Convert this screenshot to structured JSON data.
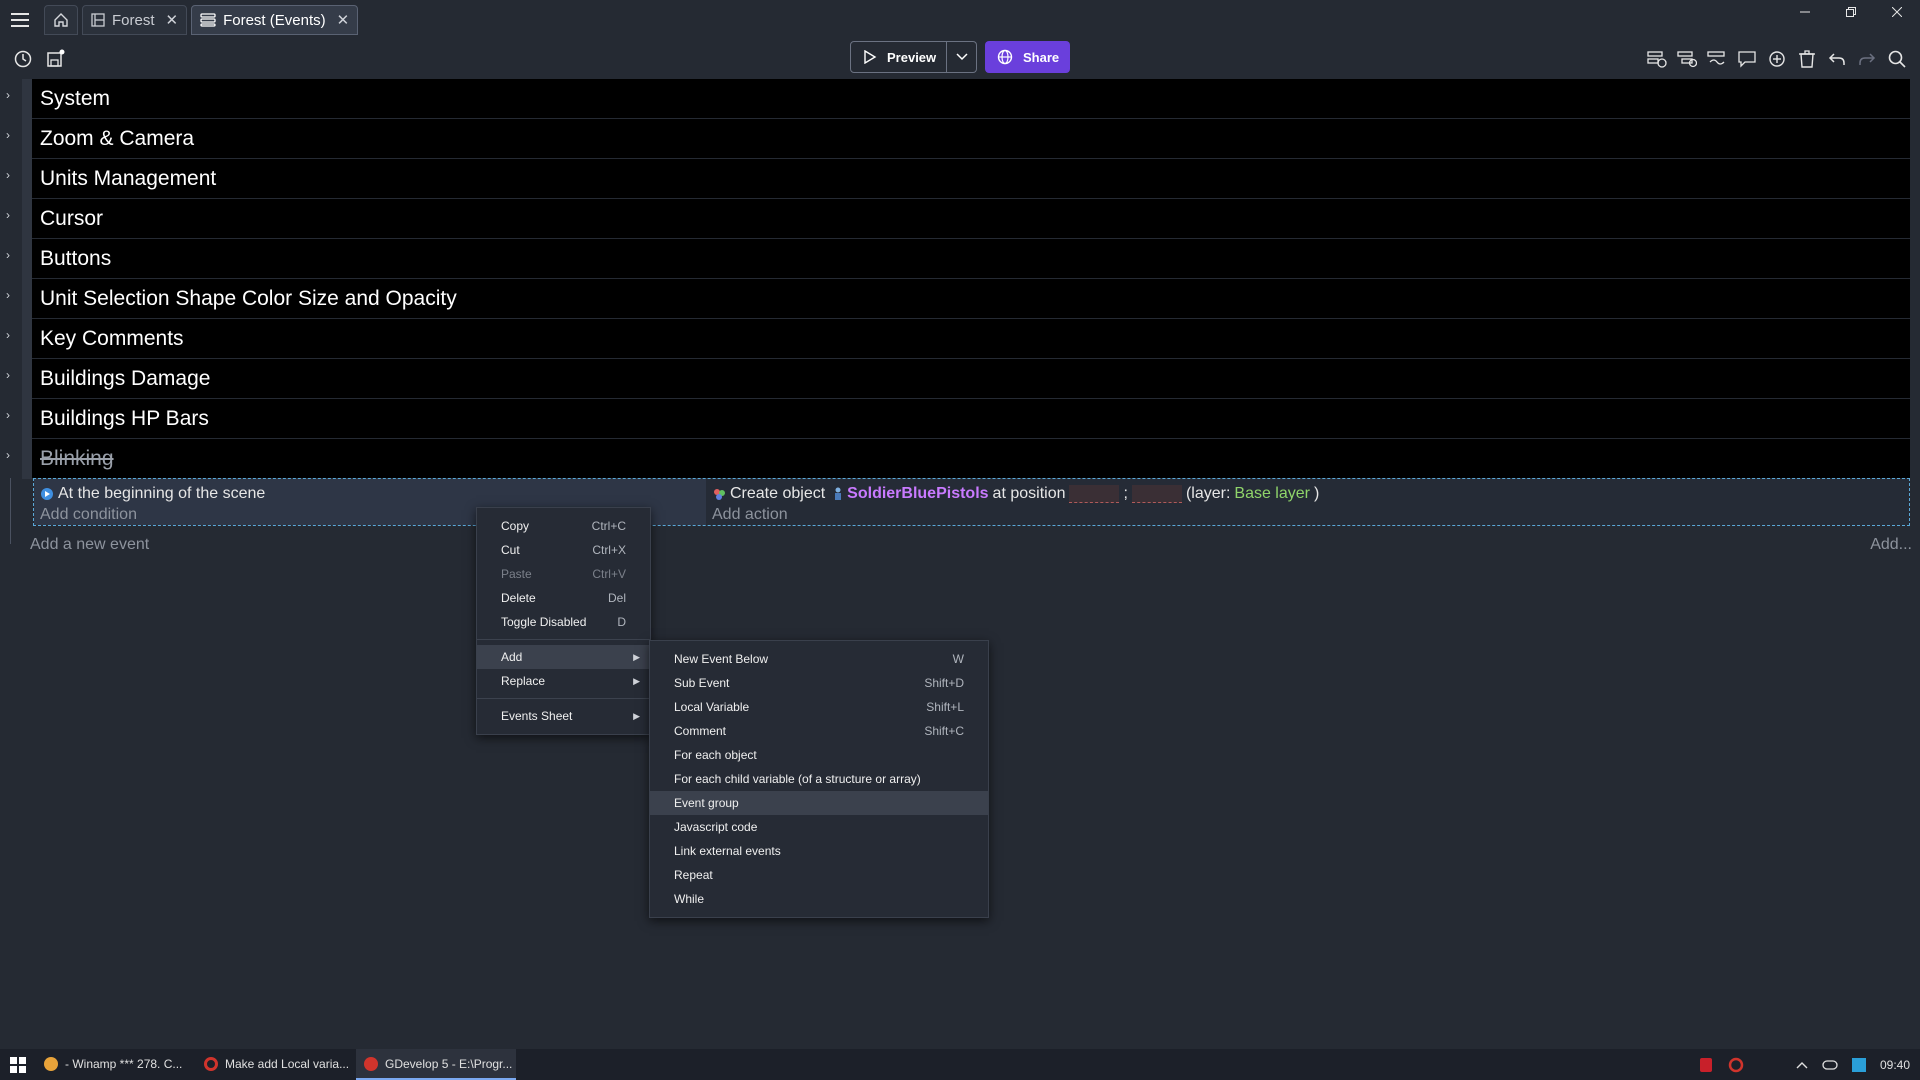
{
  "tabs": [
    {
      "label": "Forest",
      "icon": "scene-icon"
    },
    {
      "label": "Forest (Events)",
      "icon": "events-icon"
    }
  ],
  "toolbar": {
    "preview_label": "Preview",
    "share_label": "Share",
    "share_color": "#6a3fdc"
  },
  "groups": [
    {
      "label": "System",
      "disabled": false
    },
    {
      "label": "Zoom & Camera",
      "disabled": false
    },
    {
      "label": "Units Management",
      "disabled": false
    },
    {
      "label": "Cursor",
      "disabled": false
    },
    {
      "label": "Buttons",
      "disabled": false
    },
    {
      "label": "Unit Selection Shape Color Size and Opacity",
      "disabled": false
    },
    {
      "label": "Key Comments",
      "disabled": false
    },
    {
      "label": "Buildings Damage",
      "disabled": false
    },
    {
      "label": "Buildings HP Bars",
      "disabled": false
    },
    {
      "label": "Blinking",
      "disabled": true
    }
  ],
  "event": {
    "condition": "At the beginning of the scene",
    "add_condition": "Add condition",
    "action_prefix": "Create object",
    "action_object": "SoldierBluePistols",
    "action_mid": "at position",
    "action_sep": ";",
    "action_layer_open": "(layer:",
    "action_layer": "Base layer",
    "action_layer_close": ")",
    "add_action": "Add action"
  },
  "add_new_event": "Add a new event",
  "add_more": "Add...",
  "context_menu": [
    {
      "label": "Copy",
      "shortcut": "Ctrl+C",
      "enabled": true
    },
    {
      "label": "Cut",
      "shortcut": "Ctrl+X",
      "enabled": true
    },
    {
      "label": "Paste",
      "shortcut": "Ctrl+V",
      "enabled": false
    },
    {
      "label": "Delete",
      "shortcut": "Del",
      "enabled": true
    },
    {
      "label": "Toggle Disabled",
      "shortcut": "D",
      "enabled": true
    },
    {
      "label": "Add",
      "submenu": true,
      "highlight": true
    },
    {
      "label": "Replace",
      "submenu": true
    },
    {
      "label": "Events Sheet",
      "submenu": true
    }
  ],
  "add_submenu": [
    {
      "label": "New Event Below",
      "shortcut": "W"
    },
    {
      "label": "Sub Event",
      "shortcut": "Shift+D"
    },
    {
      "label": "Local Variable",
      "shortcut": "Shift+L"
    },
    {
      "label": "Comment",
      "shortcut": "Shift+C"
    },
    {
      "label": "For each object",
      "shortcut": ""
    },
    {
      "label": "For each child variable (of a structure or array)",
      "shortcut": ""
    },
    {
      "label": "Event group",
      "shortcut": "",
      "highlight": true
    },
    {
      "label": "Javascript code",
      "shortcut": ""
    },
    {
      "label": "Link external events",
      "shortcut": ""
    },
    {
      "label": "Repeat",
      "shortcut": ""
    },
    {
      "label": "While",
      "shortcut": ""
    }
  ],
  "taskbar": {
    "items": [
      {
        "label": "- Winamp *** 278. C...",
        "color": "#e8a33a"
      },
      {
        "label": "Make add Local varia...",
        "color": "#d0342c"
      },
      {
        "label": "GDevelop 5 - E:\\Progr...",
        "color": "#d0342c",
        "active": true
      }
    ],
    "clock": "09:40"
  }
}
